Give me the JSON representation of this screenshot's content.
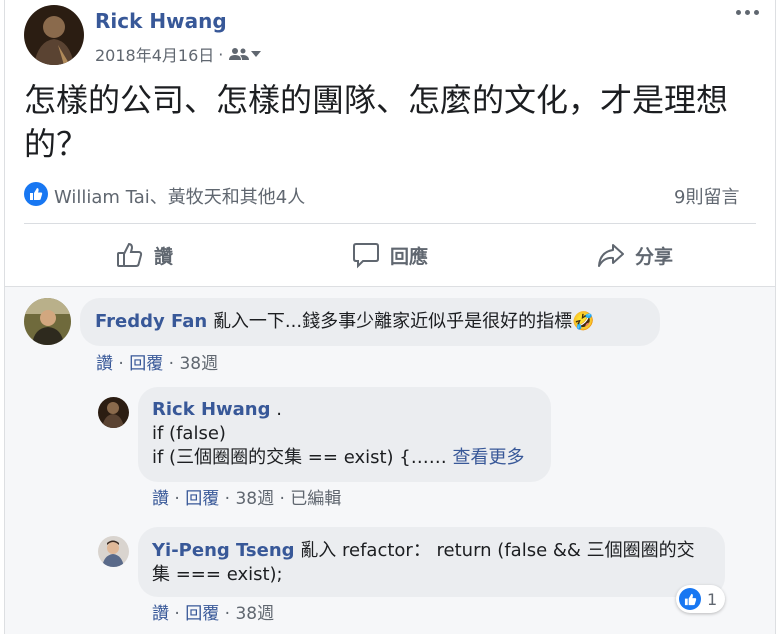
{
  "post": {
    "author": "Rick Hwang",
    "date": "2018年4月16日",
    "date_sep": "·",
    "audience_icon": "friends-icon",
    "text": "怎樣的公司、怎樣的團隊、怎麼的文化，才是理想的？",
    "reactions_text": "William Tai、黃牧天和其他4人",
    "comments_count": "9則留言"
  },
  "actions": {
    "like": "讚",
    "comment": "回應",
    "share": "分享"
  },
  "comments": [
    {
      "author": "Freddy Fan",
      "text": "亂入一下...錢多事少離家近似乎是很好的指標",
      "emoji": "🤣",
      "like": "讚",
      "reply": "回覆",
      "time": "38週"
    },
    {
      "author": "Rick Hwang",
      "text_suffix": " .",
      "line2": "if (false)",
      "line3": "if (三個圈圈的交集 == exist) {……",
      "see_more": "查看更多",
      "like": "讚",
      "reply": "回覆",
      "time": "38週",
      "edited": "已編輯"
    },
    {
      "author": "Yi-Peng Tseng",
      "text": " 亂入 refactor： return (false && 三個圈圈的交集 === exist);",
      "like": "讚",
      "reply": "回覆",
      "time": "38週",
      "reaction_count": "1"
    }
  ],
  "colors": {
    "link": "#385898",
    "meta": "#606770",
    "like_blue": "#1877f2",
    "bubble": "#ebedf0"
  }
}
